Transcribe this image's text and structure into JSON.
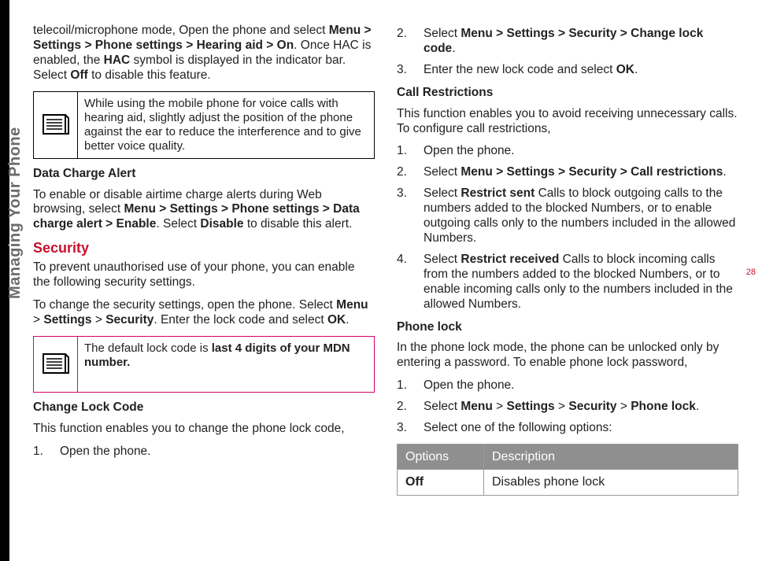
{
  "sidebar_label": "Managing Your Phone",
  "page_number": "28",
  "left": {
    "intro_html": "telecoil/microphone mode, Open the phone and select <b>Menu > Settings > Phone settings > Hearing aid > On</b>. Once HAC is enabled, the <b>HAC</b> symbol is displayed in the indicator bar. Select <b>Off</b> to disable this feature.",
    "note1": "While using the mobile phone for voice calls with hearing aid, slightly adjust the position of the phone against the ear to reduce the interference and to give better voice quality.",
    "dca_heading": "Data Charge Alert",
    "dca_html": "To enable or disable airtime charge alerts during Web browsing, select <b>Menu > Settings > Phone settings > Data charge alert > Enable</b>. Select <b>Disable</b> to disable this alert.",
    "security_heading": "Security",
    "security_p1": "To prevent unauthorised use of your phone, you can enable the following security settings.",
    "security_p2_html": "To change the security settings, open the phone. Select <b>Menu</b> > <b>Settings</b> > <b>Security</b>. Enter the lock code and select <b>OK</b>.",
    "note2_html": "The default lock code is <b>last 4 digits of your MDN number.</b>",
    "clc_heading": "Change Lock Code",
    "clc_p": "This function enables you to change the phone lock code,",
    "clc_step1": "Open the phone."
  },
  "right": {
    "clc_step2_html": "Select <b>Menu > Settings > Security > Change lock code</b>.",
    "clc_step3_html": "Enter the new lock code and select <b>OK</b>.",
    "cr_heading": "Call Restrictions",
    "cr_p": "This function enables you to avoid receiving unnecessary calls. To configure call restrictions,",
    "cr_step1": "Open the phone.",
    "cr_step2_html": "Select <b>Menu > Settings > Security > Call restrictions</b>.",
    "cr_step3_html": "Select <b>Restrict sent</b> Calls to block outgoing calls to the numbers added to the blocked Numbers, or to enable outgoing calls only to the numbers included in the allowed Numbers.",
    "cr_step4_html": "Select <b>Restrict received</b> Calls to block incoming calls from the numbers added to the blocked Numbers, or to enable incoming calls only to the numbers included in the allowed Numbers.",
    "pl_heading": "Phone lock",
    "pl_p": "In the phone lock mode, the phone can be unlocked only by entering a password. To enable phone lock password,",
    "pl_step1": "Open the phone.",
    "pl_step2_html": "Select <b>Menu</b> > <b>Settings</b> > <b>Security</b> > <b>Phone lock</b>.",
    "pl_step3": "Select one of the following options:",
    "table": {
      "h1": "Options",
      "h2": "Description",
      "r1c1": "Off",
      "r1c2": "Disables phone lock"
    }
  }
}
